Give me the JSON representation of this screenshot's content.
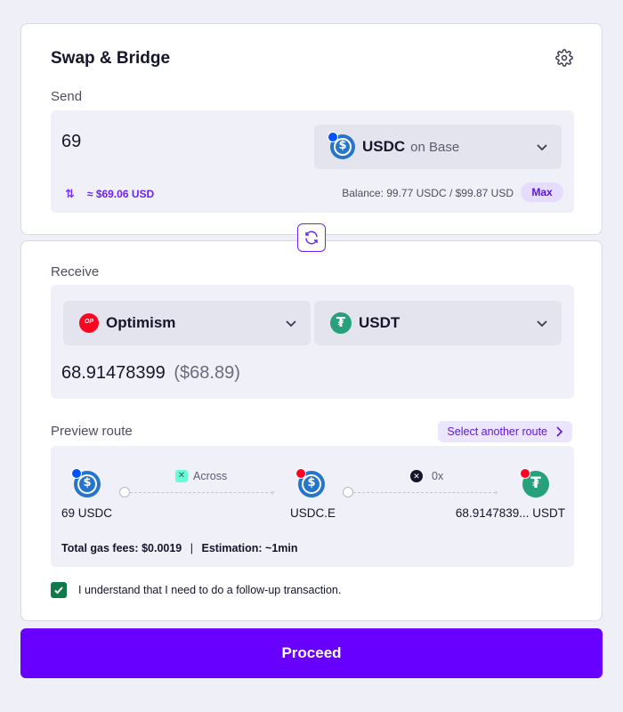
{
  "send_card": {
    "title": "Swap & Bridge",
    "section_label": "Send",
    "amount": "69",
    "token": {
      "symbol": "USDC",
      "network_text": "on Base",
      "icon": "usdc-icon",
      "chain_badge": "base-icon"
    },
    "usd_estimate": "≈ $69.06 USD",
    "balance": "Balance: 99.77 USDC / $99.87 USD",
    "max_label": "Max"
  },
  "receive_card": {
    "section_label": "Receive",
    "network": {
      "label": "Optimism",
      "icon": "optimism-icon",
      "icon_text": "OP"
    },
    "token": {
      "symbol": "USDT",
      "icon": "usdt-icon"
    },
    "amount": "68.91478399",
    "amount_usd": "($68.89)",
    "preview_label": "Preview route",
    "another_route_label": "Select another route",
    "route": {
      "steps": [
        {
          "label": "69 USDC",
          "icon": "usdc-icon",
          "badge": "base-icon"
        },
        {
          "label": "USDC.E",
          "icon": "usdc-icon",
          "badge": "optimism-icon"
        },
        {
          "label": "68.9147839... USDT",
          "icon": "usdt-icon",
          "badge": "optimism-icon"
        }
      ],
      "providers": [
        {
          "name": "Across",
          "icon": "across-icon"
        },
        {
          "name": "0x",
          "icon": "0x-icon"
        }
      ],
      "gas_fees": "Total gas fees: $0.0019",
      "separator": "|",
      "estimation": "Estimation: ~1min"
    },
    "acknowledgement": {
      "checked": true,
      "text": "I understand that I need to do a follow-up transaction."
    }
  },
  "proceed_label": "Proceed",
  "colors": {
    "accent": "#6800ff",
    "background": "#efeff7",
    "usdc": "#2775ca",
    "usdt": "#26a17b",
    "optimism": "#ff0420",
    "check": "#0e7a4a"
  }
}
